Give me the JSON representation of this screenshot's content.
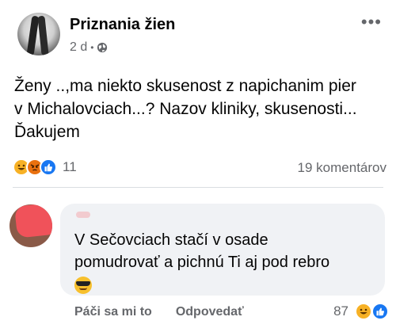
{
  "post": {
    "page_name": "Priznania žien",
    "time": "2 d",
    "separator": "•",
    "privacy_icon": "globe-icon",
    "more_icon": "•••",
    "text_lines": [
      "Ženy ..,ma niekto skusenost z napichanim pier",
      "v Michalovciach...? Nazov kliniky, skusenosti...",
      "Ďakujem"
    ],
    "reaction_icons": [
      "haha",
      "angry",
      "like"
    ],
    "reaction_count": "11",
    "comment_count": "19 komentárov"
  },
  "comment": {
    "text_line1": "V Sečovciach stačí v osade",
    "text_line2": "pomudrovať a pichnú Ti aj pod rebro",
    "emoji": "cool-sunglasses-emoji",
    "like_label": "Páči sa mi to",
    "reply_label": "Odpovedať",
    "reaction_count": "87",
    "reaction_icons": [
      "haha",
      "like"
    ]
  },
  "colors": {
    "like_blue": "#1877f2",
    "haha_yellow": "#f7b125",
    "angry_orange": "#e9710f",
    "secondary_text": "#65676b",
    "bubble_bg": "#f0f2f5"
  }
}
